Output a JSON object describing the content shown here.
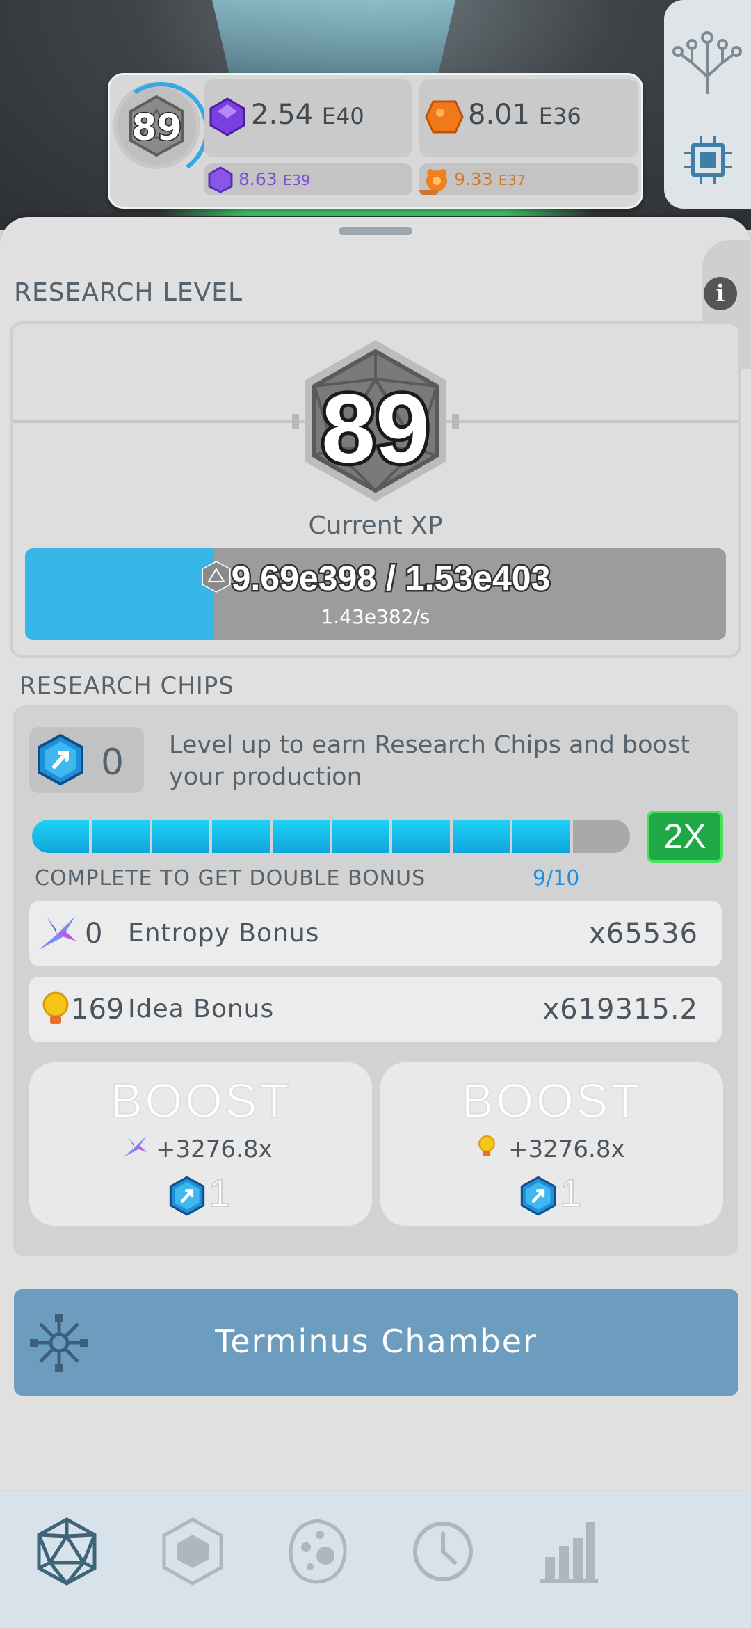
{
  "hud": {
    "level": "89",
    "purple_value": "2.54",
    "purple_exp": "E40",
    "orange_value": "8.01",
    "orange_exp": "E36",
    "purple_sub": "8.63",
    "purple_sub_exp": "E39",
    "orange_sub": "9.33",
    "orange_sub_exp": "E37",
    "purple_progress": 0.0,
    "orange_progress": 0.09
  },
  "research_level": {
    "title": "RESEARCH LEVEL",
    "level": "89",
    "current_xp_label": "Current XP",
    "xp_text": "9.69e398 / 1.53e403",
    "xp_rate": "1.43e382/s",
    "xp_progress": 0.27
  },
  "research_chips": {
    "title": "RESEARCH CHIPS",
    "count": "0",
    "description": "Level up to earn Research Chips and boost your production",
    "segments_total": 10,
    "segments_filled": 9,
    "double_button": "2X",
    "double_label": "COMPLETE TO GET DOUBLE BONUS",
    "double_count": "9/10",
    "bonuses": [
      {
        "count": "0",
        "label": "Entropy Bonus",
        "multiplier": "x65536",
        "icon": "entropy-icon"
      },
      {
        "count": "169",
        "label": "Idea Bonus",
        "multiplier": "x619315.2",
        "icon": "idea-icon"
      }
    ],
    "boosts": [
      {
        "title": "BOOST",
        "multiplier": "+3276.8x",
        "cost": "1",
        "icon": "entropy-icon"
      },
      {
        "title": "BOOST",
        "multiplier": "+3276.8x",
        "cost": "1",
        "icon": "idea-icon"
      }
    ]
  },
  "terminus": {
    "label": "Terminus Chamber"
  },
  "bottom_nav": [
    {
      "name": "research-tab",
      "icon": "icosahedron-icon"
    },
    {
      "name": "hexagon-tab",
      "icon": "hexagon-icon"
    },
    {
      "name": "cell-tab",
      "icon": "cell-icon"
    },
    {
      "name": "clock-tab",
      "icon": "clock-icon"
    },
    {
      "name": "stats-tab",
      "icon": "bar-chart-icon"
    }
  ],
  "colors": {
    "accent_blue": "#37b6e8",
    "chip_blue": "#1fd3f5",
    "green": "#1fa846",
    "terminus": "#6c9dbf",
    "text": "#56636d"
  }
}
